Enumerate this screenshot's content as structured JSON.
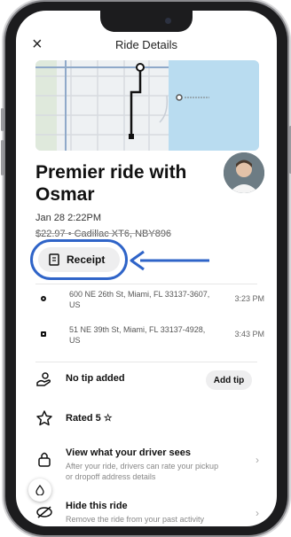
{
  "header": {
    "title": "Ride Details",
    "close_icon": "close-icon",
    "close_glyph": "×"
  },
  "ride": {
    "title": "Premier ride with Osmar",
    "date": "Jan 28 2:22PM",
    "car": "$22.97 • Cadillac XT6, NBY896"
  },
  "receipt": {
    "label": "Receipt",
    "icon": "receipt-icon",
    "highlight_color": "#2f64c8"
  },
  "stops": [
    {
      "address": "600 NE 26th St, Miami, FL 33137-3607, US",
      "time": "3:23 PM"
    },
    {
      "address": "51 NE 39th St, Miami, FL 33137-4928, US",
      "time": "3:43 PM"
    }
  ],
  "tip": {
    "label": "No tip added",
    "button": "Add tip",
    "icon": "tip-icon"
  },
  "rating": {
    "label": "Rated 5 ☆",
    "icon": "star-icon"
  },
  "driver_view": {
    "label": "View what your driver sees",
    "sub": "After your ride, drivers can rate your pickup or dropoff address details",
    "icon": "lock-icon",
    "chevron": "›"
  },
  "hide": {
    "label": "Hide this ride",
    "sub": "Remove the ride from your past activity",
    "icon": "hide-icon",
    "chevron": "›"
  },
  "map": {
    "accent": "#2f64c8"
  }
}
